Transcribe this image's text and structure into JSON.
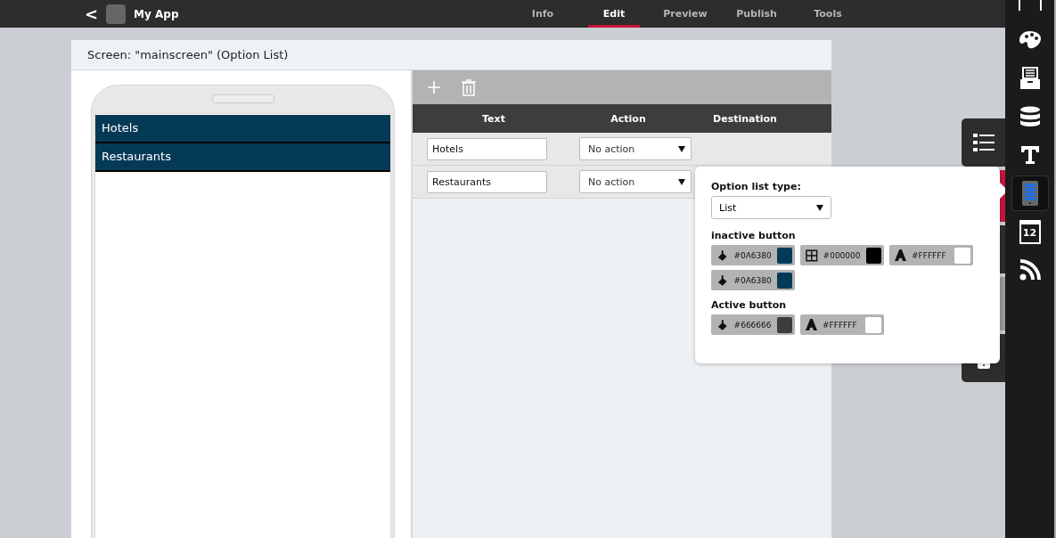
{
  "topbar": {
    "back": "<",
    "app_name": "My App",
    "tabs": [
      {
        "label": "Info",
        "selected": false
      },
      {
        "label": "Edit",
        "selected": true
      },
      {
        "label": "Preview",
        "selected": false
      },
      {
        "label": "Publish",
        "selected": false
      },
      {
        "label": "Tools",
        "selected": false
      }
    ]
  },
  "panel": {
    "title": "Screen: \"mainscreen\" (Option List)"
  },
  "phone": {
    "items": [
      "Hotels",
      "Restaurants"
    ]
  },
  "table": {
    "columns": [
      "Text",
      "Action",
      "Destination"
    ],
    "rows": [
      {
        "text": "Hotels",
        "action": "No action"
      },
      {
        "text": "Restaurants",
        "action": "No action"
      }
    ]
  },
  "popup": {
    "type_label": "Option list type:",
    "type_value": "List",
    "sections": [
      {
        "title": "inactive button",
        "swatches": [
          {
            "kind": "fill",
            "value": "#0A6380",
            "color": "#053a57"
          },
          {
            "kind": "border",
            "value": "#000000",
            "color": "#000000"
          },
          {
            "kind": "text",
            "value": "#FFFFFF",
            "color": "#ffffff"
          },
          {
            "kind": "fill",
            "value": "#0A6380",
            "color": "#053a57"
          }
        ]
      },
      {
        "title": "Active button",
        "swatches": [
          {
            "kind": "fill",
            "value": "#666666",
            "color": "#3d3d3d"
          },
          {
            "kind": "text",
            "value": "#FFFFFF",
            "color": "#ffffff"
          }
        ]
      }
    ]
  },
  "sidebar": {
    "items": [
      {
        "kind": "frame",
        "selected": false
      },
      {
        "kind": "palette",
        "selected": false
      },
      {
        "kind": "archive",
        "selected": false
      },
      {
        "kind": "database",
        "selected": false
      },
      {
        "kind": "text",
        "selected": false
      },
      {
        "kind": "phone",
        "selected": true
      },
      {
        "kind": "calendar",
        "selected": false,
        "label": "12"
      },
      {
        "kind": "rss",
        "selected": false
      }
    ]
  }
}
